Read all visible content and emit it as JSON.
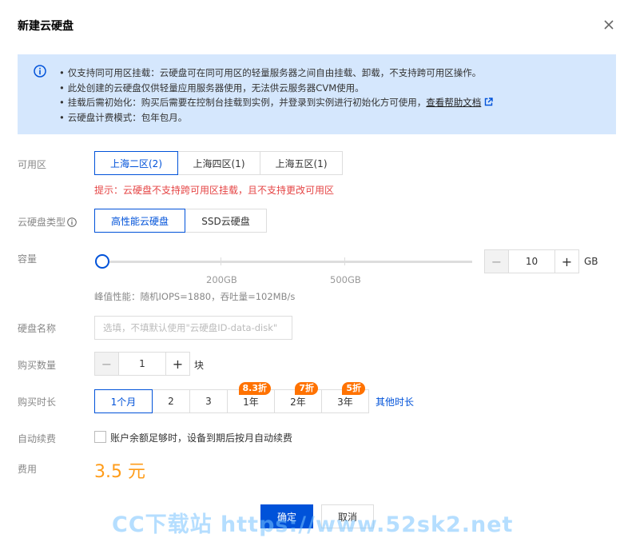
{
  "dialog": {
    "title": "新建云硬盘",
    "close_icon": "close-icon"
  },
  "notice": {
    "icon": "info-icon",
    "items": [
      "仅支持同可用区挂载：云硬盘可在同可用区的轻量服务器之间自由挂载、卸载，不支持跨可用区操作。",
      "此处创建的云硬盘仅供轻量应用服务器使用，无法供云服务器CVM使用。",
      "挂载后需初始化：购买后需要在控制台挂载到实例，并登录到实例进行初始化方可使用，",
      "云硬盘计费模式：包年包月。"
    ],
    "help_link": "查看帮助文档",
    "link_icon": "external-link-icon",
    "bullet": "•"
  },
  "zone": {
    "label": "可用区",
    "options": [
      "上海二区(2)",
      "上海四区(1)",
      "上海五区(1)"
    ],
    "selected": "上海二区(2)",
    "hint": "提示：云硬盘不支持跨可用区挂载，且不支持更改可用区"
  },
  "disk_type": {
    "label": "云硬盘类型",
    "help_icon": "question-circle-icon",
    "options": [
      "高性能云硬盘",
      "SSD云硬盘"
    ],
    "selected": "高性能云硬盘"
  },
  "capacity": {
    "label": "容量",
    "value": "10",
    "unit": "GB",
    "ticks": [
      "200GB",
      "500GB"
    ],
    "slider_fraction": 0.0,
    "performance": "峰值性能：随机IOPS=1880，吞吐量=102MB/s",
    "minus": "−",
    "plus": "+"
  },
  "disk_name": {
    "label": "硬盘名称",
    "placeholder": "选填，不填默认使用\"云硬盘ID-data-disk\"",
    "value": ""
  },
  "quantity": {
    "label": "购买数量",
    "value": "1",
    "unit": "块",
    "minus": "−",
    "plus": "+"
  },
  "duration": {
    "label": "购买时长",
    "options": [
      {
        "label": "1个月",
        "badge": ""
      },
      {
        "label": "2",
        "badge": ""
      },
      {
        "label": "3",
        "badge": ""
      },
      {
        "label": "1年",
        "badge": "8.3折"
      },
      {
        "label": "2年",
        "badge": "7折"
      },
      {
        "label": "3年",
        "badge": "5折"
      }
    ],
    "selected": "1个月",
    "more": "其他时长"
  },
  "auto_renew": {
    "label": "自动续费",
    "checkbox_label": "账户余额足够时，设备到期后按月自动续费",
    "checked": false
  },
  "fee": {
    "label": "费用",
    "amount": "3.5 元"
  },
  "footer": {
    "ok": "确定",
    "cancel": "取消"
  },
  "watermark": "CC下载站 https://www.52sk2.net",
  "colors": {
    "primary": "#0052d9",
    "warning": "#e54545",
    "price": "#ff9c19",
    "badge": "#ff7200",
    "notice_bg": "#d5e7fd"
  }
}
